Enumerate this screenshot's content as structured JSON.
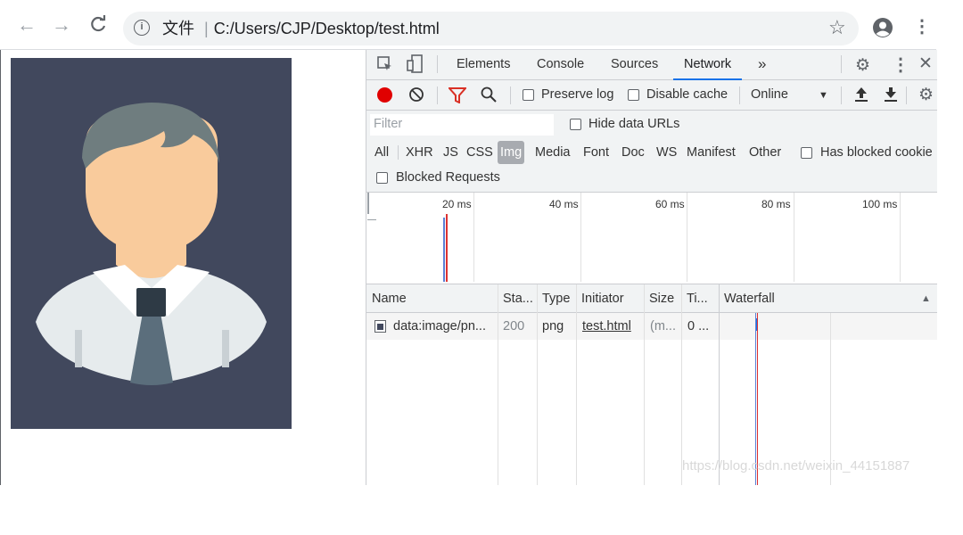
{
  "browser": {
    "url_scheme_label": "文件",
    "url_separator": "|",
    "url": "C:/Users/CJP/Desktop/test.html"
  },
  "devtools": {
    "tabs": [
      "Elements",
      "Console",
      "Sources",
      "Network"
    ],
    "active_tab": "Network",
    "more_tabs_glyph": "»",
    "toolbar": {
      "preserve_log": "Preserve log",
      "disable_cache": "Disable cache",
      "throttling": "Online"
    },
    "filter": {
      "placeholder": "Filter",
      "hide_data_urls": "Hide data URLs"
    },
    "types": [
      "All",
      "XHR",
      "JS",
      "CSS",
      "Img",
      "Media",
      "Font",
      "Doc",
      "WS",
      "Manifest",
      "Other"
    ],
    "active_type": "Img",
    "has_blocked_cookies": "Has blocked cookie",
    "blocked_requests": "Blocked Requests",
    "timeline_ticks": [
      "20 ms",
      "40 ms",
      "60 ms",
      "80 ms",
      "100 ms"
    ],
    "columns": [
      "Name",
      "Sta...",
      "Type",
      "Initiator",
      "Size",
      "Ti...",
      "Waterfall"
    ],
    "rows": [
      {
        "name": "data:image/pn...",
        "status": "200",
        "type": "png",
        "initiator": "test.html",
        "size": "(m...",
        "time": "0 ..."
      }
    ]
  },
  "watermark": "https://blog.csdn.net/weixin_44151887",
  "colors": {
    "avatar_bg": "#41485d",
    "record": "#e00000",
    "filter_active": "#d93025",
    "tab_underline": "#1a73e8"
  }
}
